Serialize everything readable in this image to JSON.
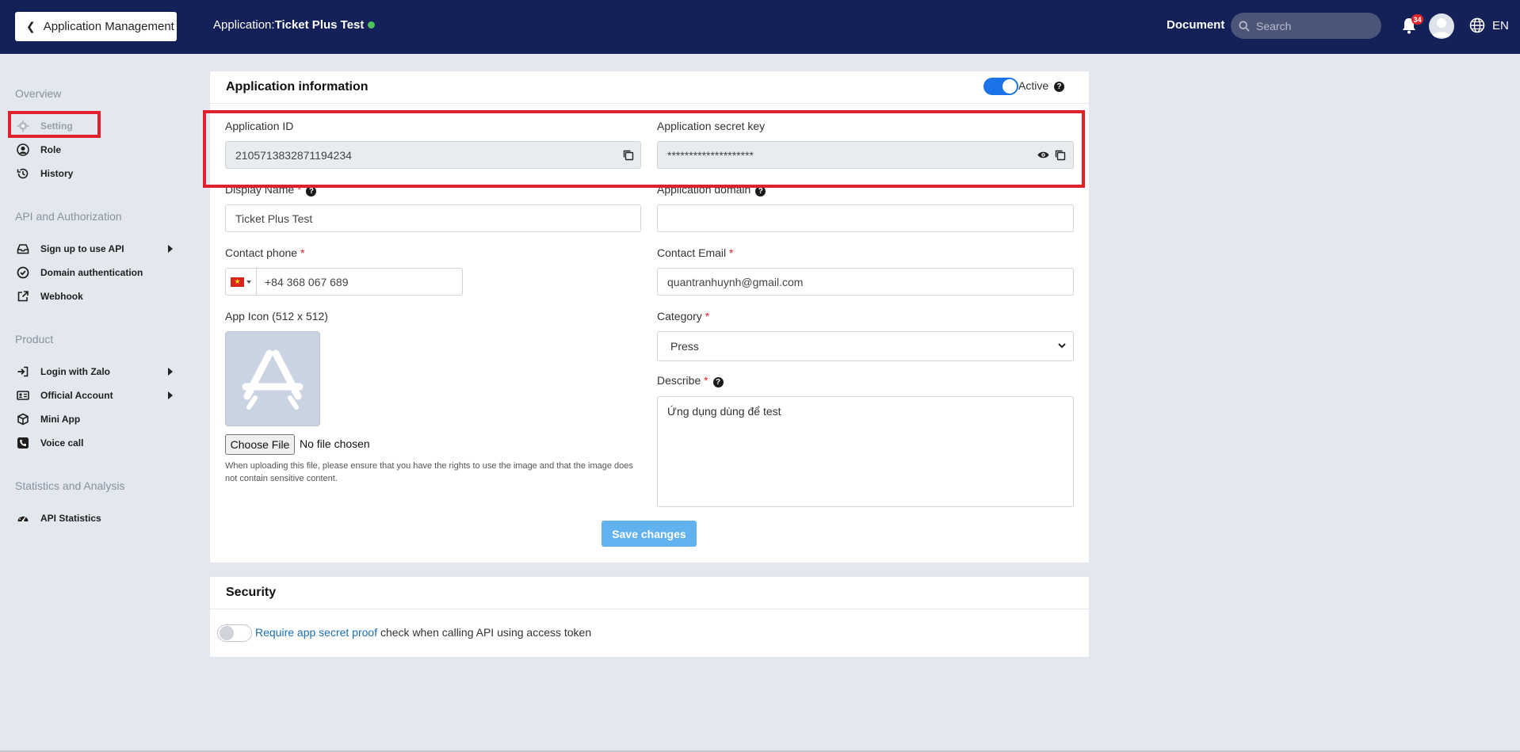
{
  "header": {
    "back_label": "Application Management",
    "app_prefix": "Application:",
    "app_name": "Ticket Plus Test",
    "document_label": "Document",
    "search_placeholder": "Search",
    "notification_count": "34",
    "language": "EN"
  },
  "sidebar": {
    "sections": [
      {
        "title": "Overview",
        "items": [
          {
            "label": "Setting"
          },
          {
            "label": "Role"
          },
          {
            "label": "History"
          }
        ]
      },
      {
        "title": "API and Authorization",
        "items": [
          {
            "label": "Sign up to use API"
          },
          {
            "label": "Domain authentication"
          },
          {
            "label": "Webhook"
          }
        ]
      },
      {
        "title": "Product",
        "items": [
          {
            "label": "Login with Zalo"
          },
          {
            "label": "Official Account"
          },
          {
            "label": "Mini App"
          },
          {
            "label": "Voice call"
          }
        ]
      },
      {
        "title": "Statistics and Analysis",
        "items": [
          {
            "label": "API Statistics"
          }
        ]
      }
    ]
  },
  "app_info": {
    "title": "Application information",
    "active_label": "Active",
    "active": true,
    "app_id_label": "Application ID",
    "app_id_value": "2105713832871194234",
    "secret_label": "Application secret key",
    "secret_value": "********************",
    "display_name_label": "Display Name",
    "display_name_value": "Ticket Plus Test",
    "domain_label": "Application domain",
    "domain_value": "",
    "phone_label": "Contact phone",
    "phone_value": "+84 368 067 689",
    "email_label": "Contact Email",
    "email_value": "quantranhuynh@gmail.com",
    "icon_label": "App Icon (512 x 512)",
    "category_label": "Category",
    "category_value": "Press",
    "describe_label": "Describe",
    "describe_value": "Ứng dụng dùng để test",
    "choose_file_label": "Choose File",
    "file_status": "No file chosen",
    "file_note": "When uploading this file, please ensure that you have the rights to use the image and that the image does not contain sensitive content.",
    "save_label": "Save changes",
    "required_mark": "*"
  },
  "security": {
    "title": "Security",
    "toggle_on": false,
    "link_text": "Require app secret proof",
    "rest_text": " check when calling API using access token"
  },
  "colors": {
    "header_bg": "#142158",
    "toggle_on": "#1a73e8",
    "save_btn": "#62b2ef",
    "highlight": "#e0212b"
  }
}
